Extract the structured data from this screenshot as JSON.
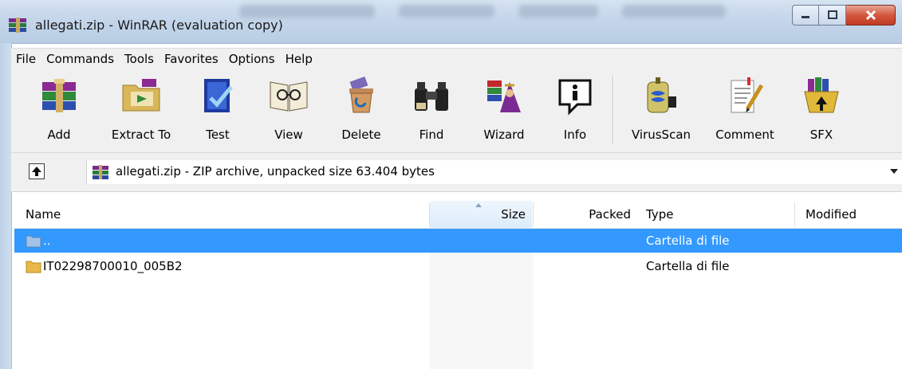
{
  "window": {
    "title": "allegati.zip - WinRAR (evaluation copy)"
  },
  "menu": [
    "File",
    "Commands",
    "Tools",
    "Favorites",
    "Options",
    "Help"
  ],
  "toolbar": [
    {
      "label": "Add",
      "icon": "add-archive-icon"
    },
    {
      "label": "Extract To",
      "icon": "extract-to-icon"
    },
    {
      "label": "Test",
      "icon": "test-icon"
    },
    {
      "label": "View",
      "icon": "view-icon"
    },
    {
      "label": "Delete",
      "icon": "delete-icon"
    },
    {
      "label": "Find",
      "icon": "find-binoculars-icon"
    },
    {
      "label": "Wizard",
      "icon": "wizard-icon"
    },
    {
      "label": "Info",
      "icon": "info-icon"
    },
    {
      "label": "VirusScan",
      "icon": "virusscan-icon"
    },
    {
      "label": "Comment",
      "icon": "comment-icon"
    },
    {
      "label": "SFX",
      "icon": "sfx-icon"
    }
  ],
  "address": {
    "text": "allegati.zip - ZIP archive, unpacked size 63.404 bytes"
  },
  "columns": {
    "name": "Name",
    "size": "Size",
    "packed": "Packed",
    "type": "Type",
    "modified": "Modified"
  },
  "rows": [
    {
      "name": "..",
      "size": "",
      "packed": "",
      "type": "Cartella di file",
      "modified": "",
      "selected": true
    },
    {
      "name": "IT02298700010_005B2",
      "size": "",
      "packed": "",
      "type": "Cartella di file",
      "modified": "",
      "selected": false
    }
  ],
  "colors": {
    "selection": "#3399ff",
    "close_button": "#c03a22",
    "folder": "#e8b84a"
  }
}
